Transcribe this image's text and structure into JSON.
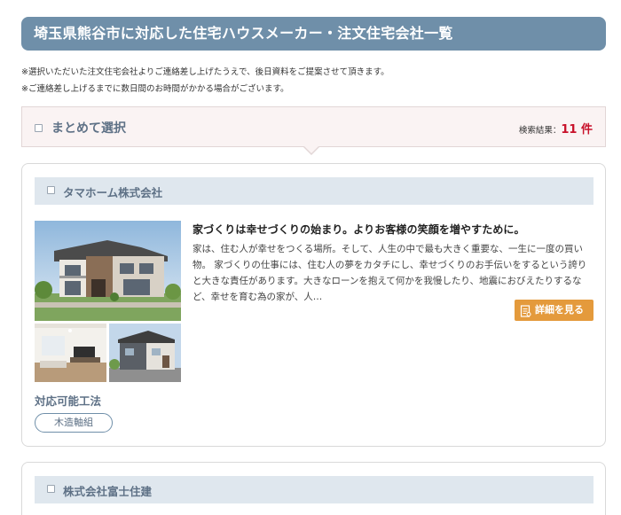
{
  "page": {
    "title": "埼玉県熊谷市に対応した住宅ハウスメーカー・注文住宅会社一覧",
    "notes": [
      "※選択いただいた注文住宅会社よりご連絡差し上げたうえで、後日資料をご提案させて頂きます。",
      "※ご連絡差し上げるまでに数日間のお時間がかかる場合がございます。"
    ]
  },
  "select_bar": {
    "label": "まとめて選択",
    "result_label": "検索結果：",
    "result_count": "11",
    "result_unit": "件"
  },
  "companies": [
    {
      "name": "タマホーム株式会社",
      "headline": "家づくりは幸せづくりの始まり。よりお客様の笑顔を増やすために。",
      "description": "家は、住む人が幸せをつくる場所。そして、人生の中で最も大きく重要な、一生に一度の買い物。 家づくりの仕事には、住む人の夢をカタチにし、幸せづくりのお手伝いをするという誇りと大きな責任があります。大きなローンを抱えて何かを我慢したり、地震におびえたりするなど、幸せを育む為の家が、人…",
      "detail_button": "詳細を見る",
      "methods_title": "対応可能工法",
      "methods": [
        "木造軸組"
      ]
    },
    {
      "name": "株式会社富士住建"
    }
  ],
  "colors": {
    "title_bar": "#6f8fa9",
    "company_bar": "#dfe7ee",
    "select_bar": "#faf3f3",
    "accent_count": "#c8112a",
    "detail_button": "#e49a3c"
  },
  "icons": {
    "detail_button_icon": "document-icon",
    "checkbox": "checkbox-icon"
  }
}
